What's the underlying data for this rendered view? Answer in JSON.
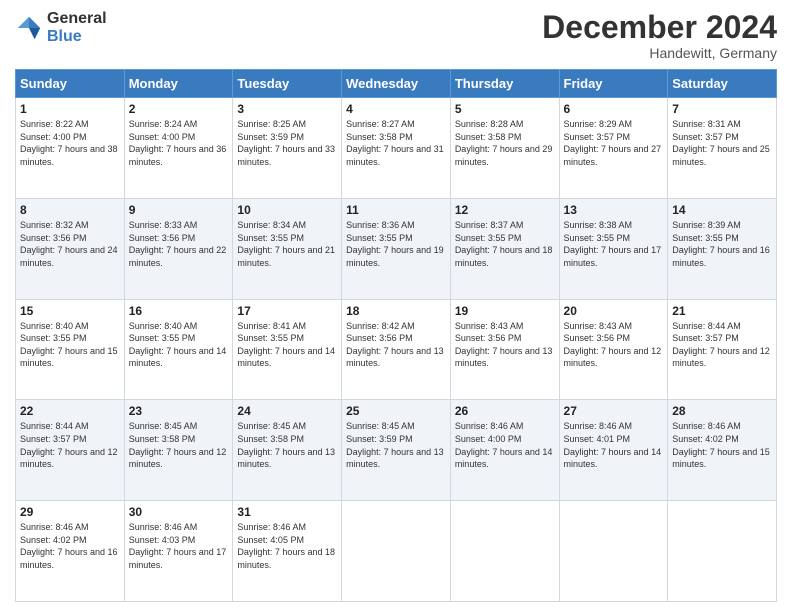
{
  "logo": {
    "general": "General",
    "blue": "Blue"
  },
  "title": "December 2024",
  "location": "Handewitt, Germany",
  "days_header": [
    "Sunday",
    "Monday",
    "Tuesday",
    "Wednesday",
    "Thursday",
    "Friday",
    "Saturday"
  ],
  "weeks": [
    [
      {
        "day": "1",
        "sunrise": "8:22 AM",
        "sunset": "4:00 PM",
        "daylight": "7 hours and 38 minutes."
      },
      {
        "day": "2",
        "sunrise": "8:24 AM",
        "sunset": "4:00 PM",
        "daylight": "7 hours and 36 minutes."
      },
      {
        "day": "3",
        "sunrise": "8:25 AM",
        "sunset": "3:59 PM",
        "daylight": "7 hours and 33 minutes."
      },
      {
        "day": "4",
        "sunrise": "8:27 AM",
        "sunset": "3:58 PM",
        "daylight": "7 hours and 31 minutes."
      },
      {
        "day": "5",
        "sunrise": "8:28 AM",
        "sunset": "3:58 PM",
        "daylight": "7 hours and 29 minutes."
      },
      {
        "day": "6",
        "sunrise": "8:29 AM",
        "sunset": "3:57 PM",
        "daylight": "7 hours and 27 minutes."
      },
      {
        "day": "7",
        "sunrise": "8:31 AM",
        "sunset": "3:57 PM",
        "daylight": "7 hours and 25 minutes."
      }
    ],
    [
      {
        "day": "8",
        "sunrise": "8:32 AM",
        "sunset": "3:56 PM",
        "daylight": "7 hours and 24 minutes."
      },
      {
        "day": "9",
        "sunrise": "8:33 AM",
        "sunset": "3:56 PM",
        "daylight": "7 hours and 22 minutes."
      },
      {
        "day": "10",
        "sunrise": "8:34 AM",
        "sunset": "3:55 PM",
        "daylight": "7 hours and 21 minutes."
      },
      {
        "day": "11",
        "sunrise": "8:36 AM",
        "sunset": "3:55 PM",
        "daylight": "7 hours and 19 minutes."
      },
      {
        "day": "12",
        "sunrise": "8:37 AM",
        "sunset": "3:55 PM",
        "daylight": "7 hours and 18 minutes."
      },
      {
        "day": "13",
        "sunrise": "8:38 AM",
        "sunset": "3:55 PM",
        "daylight": "7 hours and 17 minutes."
      },
      {
        "day": "14",
        "sunrise": "8:39 AM",
        "sunset": "3:55 PM",
        "daylight": "7 hours and 16 minutes."
      }
    ],
    [
      {
        "day": "15",
        "sunrise": "8:40 AM",
        "sunset": "3:55 PM",
        "daylight": "7 hours and 15 minutes."
      },
      {
        "day": "16",
        "sunrise": "8:40 AM",
        "sunset": "3:55 PM",
        "daylight": "7 hours and 14 minutes."
      },
      {
        "day": "17",
        "sunrise": "8:41 AM",
        "sunset": "3:55 PM",
        "daylight": "7 hours and 14 minutes."
      },
      {
        "day": "18",
        "sunrise": "8:42 AM",
        "sunset": "3:56 PM",
        "daylight": "7 hours and 13 minutes."
      },
      {
        "day": "19",
        "sunrise": "8:43 AM",
        "sunset": "3:56 PM",
        "daylight": "7 hours and 13 minutes."
      },
      {
        "day": "20",
        "sunrise": "8:43 AM",
        "sunset": "3:56 PM",
        "daylight": "7 hours and 12 minutes."
      },
      {
        "day": "21",
        "sunrise": "8:44 AM",
        "sunset": "3:57 PM",
        "daylight": "7 hours and 12 minutes."
      }
    ],
    [
      {
        "day": "22",
        "sunrise": "8:44 AM",
        "sunset": "3:57 PM",
        "daylight": "7 hours and 12 minutes."
      },
      {
        "day": "23",
        "sunrise": "8:45 AM",
        "sunset": "3:58 PM",
        "daylight": "7 hours and 12 minutes."
      },
      {
        "day": "24",
        "sunrise": "8:45 AM",
        "sunset": "3:58 PM",
        "daylight": "7 hours and 13 minutes."
      },
      {
        "day": "25",
        "sunrise": "8:45 AM",
        "sunset": "3:59 PM",
        "daylight": "7 hours and 13 minutes."
      },
      {
        "day": "26",
        "sunrise": "8:46 AM",
        "sunset": "4:00 PM",
        "daylight": "7 hours and 14 minutes."
      },
      {
        "day": "27",
        "sunrise": "8:46 AM",
        "sunset": "4:01 PM",
        "daylight": "7 hours and 14 minutes."
      },
      {
        "day": "28",
        "sunrise": "8:46 AM",
        "sunset": "4:02 PM",
        "daylight": "7 hours and 15 minutes."
      }
    ],
    [
      {
        "day": "29",
        "sunrise": "8:46 AM",
        "sunset": "4:02 PM",
        "daylight": "7 hours and 16 minutes."
      },
      {
        "day": "30",
        "sunrise": "8:46 AM",
        "sunset": "4:03 PM",
        "daylight": "7 hours and 17 minutes."
      },
      {
        "day": "31",
        "sunrise": "8:46 AM",
        "sunset": "4:05 PM",
        "daylight": "7 hours and 18 minutes."
      },
      null,
      null,
      null,
      null
    ]
  ]
}
